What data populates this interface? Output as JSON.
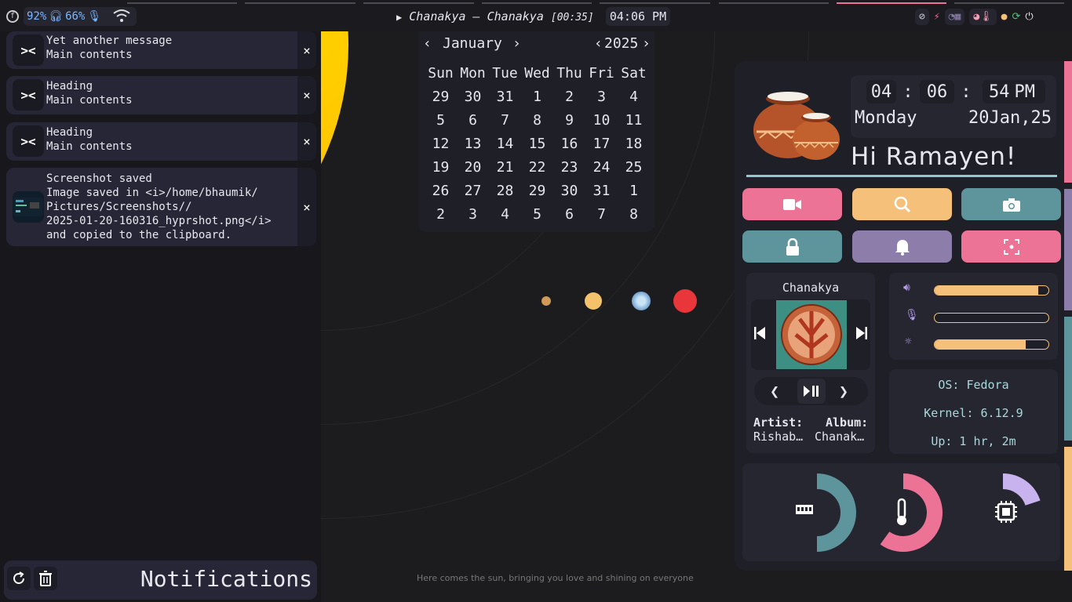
{
  "topbar": {
    "battery": "92%",
    "headset": "66%",
    "media_title": "Chanakya – Chanakya",
    "media_time": "[00:35]",
    "clock": "04:06 PM"
  },
  "notifications": {
    "items": [
      {
        "title": "Yet another message",
        "body": "Main contents"
      },
      {
        "title": "Heading",
        "body": "Main contents"
      },
      {
        "title": "Heading",
        "body": "Main contents"
      },
      {
        "title": "Screenshot saved",
        "body": "Image saved in <i>/home/bhaumik/\nPictures/Screenshots//\n2025-01-20-160316_hyprshot.png</i>\nand copied to the clipboard."
      }
    ],
    "panel_title": "Notifications",
    "close_glyph": "×"
  },
  "calendar": {
    "month": "January",
    "year": "2025",
    "weekdays": [
      "Sun",
      "Mon",
      "Tue",
      "Wed",
      "Thu",
      "Fri",
      "Sat"
    ],
    "weeks": [
      [
        "29",
        "30",
        "31",
        "1",
        "2",
        "3",
        "4"
      ],
      [
        "5",
        "6",
        "7",
        "8",
        "9",
        "10",
        "11"
      ],
      [
        "12",
        "13",
        "14",
        "15",
        "16",
        "17",
        "18"
      ],
      [
        "19",
        "20",
        "21",
        "22",
        "23",
        "24",
        "25"
      ],
      [
        "26",
        "27",
        "28",
        "29",
        "30",
        "31",
        "1"
      ],
      [
        "2",
        "3",
        "4",
        "5",
        "6",
        "7",
        "8"
      ]
    ]
  },
  "dashboard": {
    "hour": "04",
    "minute": "06",
    "second": "54",
    "ampm": "PM",
    "sep": ":",
    "weekday": "Monday",
    "date": "20Jan,25",
    "greeting": "Hi Ramayen!",
    "quick_buttons": [
      {
        "icon": "video-icon",
        "color": "#ec7296"
      },
      {
        "icon": "search-icon",
        "color": "#f5c07a"
      },
      {
        "icon": "camera-icon",
        "color": "#5e949c"
      },
      {
        "icon": "lock-icon",
        "color": "#5e949c"
      },
      {
        "icon": "bell-icon",
        "color": "#8c7daa"
      },
      {
        "icon": "screen-focus-icon",
        "color": "#ec7296"
      }
    ],
    "player": {
      "track": "Chanakya",
      "artist_label": "Artist:",
      "artist": "Rishab…",
      "album_label": "Album:",
      "album": "Chanak…"
    },
    "sliders": {
      "volume": 0.91,
      "microphone": 0.0,
      "brightness": 0.8
    },
    "sysinfo": {
      "os": "OS: Fedora",
      "kernel": "Kernel: 6.12.9",
      "uptime": "Up: 1 hr, 2m"
    },
    "gauges": {
      "ram": 0.5,
      "temperature": 0.6,
      "cpu": 0.2
    }
  },
  "wallpaper": {
    "quote": "Here comes the sun, bringing you love and shining on everyone"
  },
  "colors": {
    "accent_pink": "#ec7296",
    "accent_yellow": "#f5c07a",
    "accent_teal": "#5e949c",
    "accent_purple": "#8c7daa",
    "battery_blue": "#7ab8ff"
  }
}
